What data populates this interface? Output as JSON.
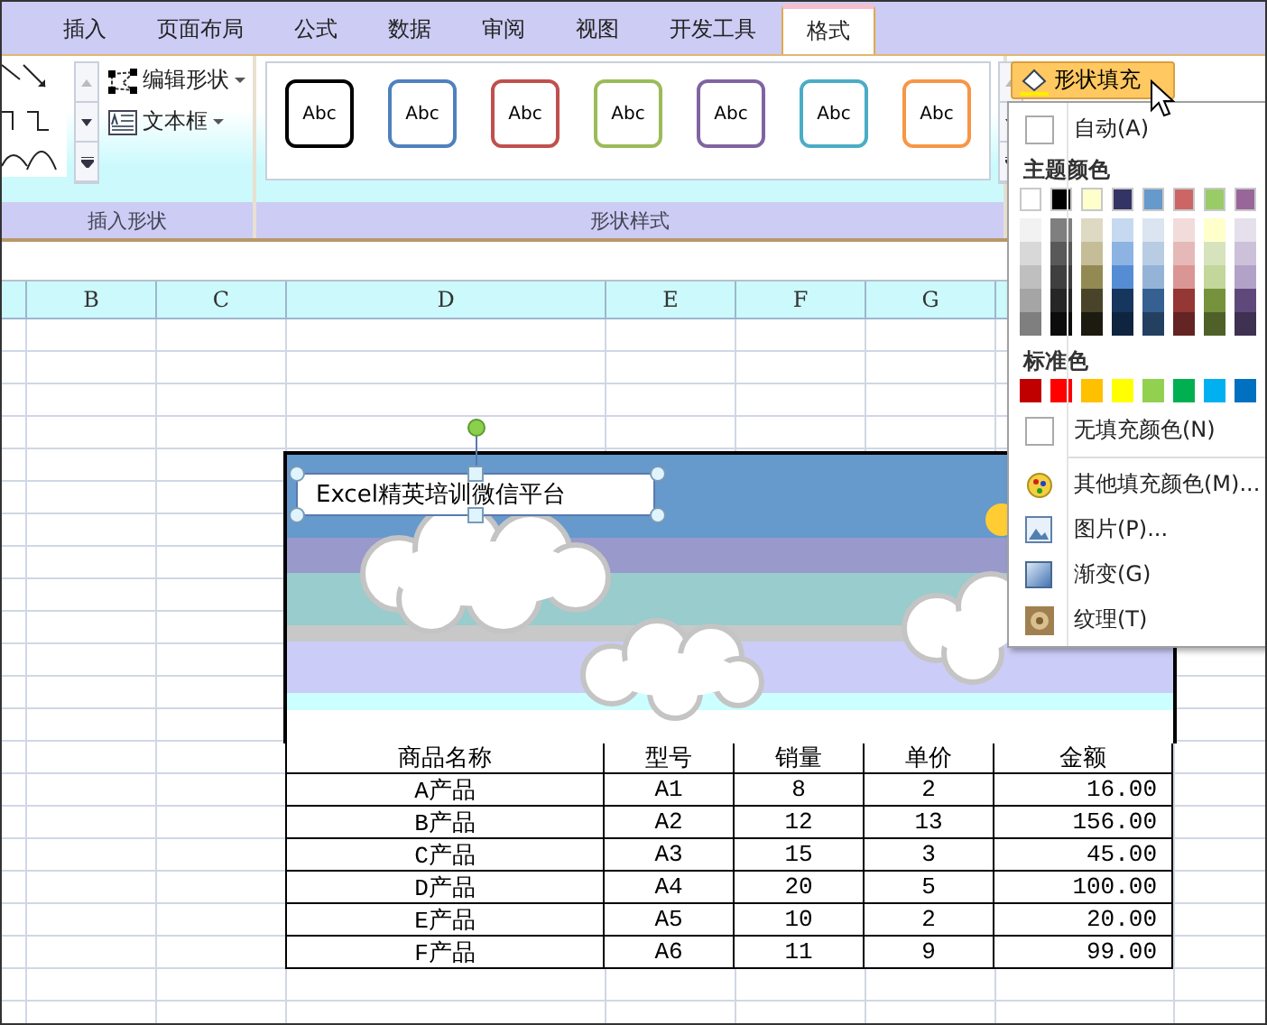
{
  "ribbon_tabs": [
    {
      "label": "插入",
      "selected": false
    },
    {
      "label": "页面布局",
      "selected": false
    },
    {
      "label": "公式",
      "selected": false
    },
    {
      "label": "数据",
      "selected": false
    },
    {
      "label": "审阅",
      "selected": false
    },
    {
      "label": "视图",
      "selected": false
    },
    {
      "label": "开发工具",
      "selected": false
    },
    {
      "label": "格式",
      "selected": true
    }
  ],
  "insert_shapes_group": {
    "label": "插入形状",
    "buttons": [
      {
        "kind": "edit-shape",
        "label": "编辑形状"
      },
      {
        "kind": "text-box",
        "label": "文本框"
      }
    ]
  },
  "shape_styles_group": {
    "label": "形状样式",
    "styles": [
      {
        "label": "Abc",
        "color": "#000000"
      },
      {
        "label": "Abc",
        "color": "#4f81bd"
      },
      {
        "label": "Abc",
        "color": "#c0504d"
      },
      {
        "label": "Abc",
        "color": "#9bbb59"
      },
      {
        "label": "Abc",
        "color": "#8064a2"
      },
      {
        "label": "Abc",
        "color": "#4bacc6"
      },
      {
        "label": "Abc",
        "color": "#f79646"
      }
    ]
  },
  "shape_fill_button": {
    "label": "形状填充"
  },
  "columns": [
    {
      "label": "B"
    },
    {
      "label": "C"
    },
    {
      "label": "D"
    },
    {
      "label": "E"
    },
    {
      "label": "F"
    },
    {
      "label": "G"
    }
  ],
  "text_box": {
    "text": "Excel精英培训微信平台"
  },
  "table": {
    "columns": [
      "商品名称",
      "型号",
      "销量",
      "单价",
      "金额"
    ],
    "rows": [
      [
        "A产品",
        "A1",
        "8",
        "2",
        "16.00"
      ],
      [
        "B产品",
        "A2",
        "12",
        "13",
        "156.00"
      ],
      [
        "C产品",
        "A3",
        "15",
        "3",
        "45.00"
      ],
      [
        "D产品",
        "A4",
        "20",
        "5",
        "100.00"
      ],
      [
        "E产品",
        "A5",
        "10",
        "2",
        "20.00"
      ],
      [
        "F产品",
        "A6",
        "11",
        "9",
        "99.00"
      ]
    ]
  },
  "fill_menu": {
    "auto": "自动(A)",
    "theme_label": "主题颜色",
    "theme_colors": [
      {
        "color": "#ffffff",
        "shades": [
          {
            "color": "#f2f2f2"
          },
          {
            "color": "#d8d8d8"
          },
          {
            "color": "#bfbfbf"
          },
          {
            "color": "#a5a5a5"
          },
          {
            "color": "#7f7f7f"
          }
        ]
      },
      {
        "color": "#000000",
        "shades": [
          {
            "color": "#7f7f7f"
          },
          {
            "color": "#595959"
          },
          {
            "color": "#3f3f3f"
          },
          {
            "color": "#262626"
          },
          {
            "color": "#0c0c0c"
          }
        ]
      },
      {
        "color": "#ffffcc",
        "shades": [
          {
            "color": "#ddd9c3"
          },
          {
            "color": "#c4bd97"
          },
          {
            "color": "#938953"
          },
          {
            "color": "#494429"
          },
          {
            "color": "#1d1b10"
          }
        ]
      },
      {
        "color": "#333366",
        "shades": [
          {
            "color": "#c6d9f0"
          },
          {
            "color": "#8db3e2"
          },
          {
            "color": "#548dd4"
          },
          {
            "color": "#17365d"
          },
          {
            "color": "#0f243e"
          }
        ]
      },
      {
        "color": "#6699cc",
        "shades": [
          {
            "color": "#dbe5f1"
          },
          {
            "color": "#b8cce4"
          },
          {
            "color": "#95b3d7"
          },
          {
            "color": "#366092"
          },
          {
            "color": "#244061"
          }
        ]
      },
      {
        "color": "#cc6666",
        "shades": [
          {
            "color": "#f2dcdb"
          },
          {
            "color": "#e5b9b7"
          },
          {
            "color": "#d99694"
          },
          {
            "color": "#953734"
          },
          {
            "color": "#632423"
          }
        ]
      },
      {
        "color": "#99cc66",
        "shades": [
          {
            "color": "#ffffcc"
          },
          {
            "color": "#d7e3bc"
          },
          {
            "color": "#c3d69b"
          },
          {
            "color": "#76923c"
          },
          {
            "color": "#4f6128"
          }
        ]
      },
      {
        "color": "#996699",
        "shades": [
          {
            "color": "#e5e0ec"
          },
          {
            "color": "#ccc1d9"
          },
          {
            "color": "#b2a2c7"
          },
          {
            "color": "#5f497a"
          },
          {
            "color": "#3f3151"
          }
        ]
      }
    ],
    "standard_label": "标准色",
    "standard_colors": [
      {
        "color": "#c00000"
      },
      {
        "color": "#ff0000"
      },
      {
        "color": "#ffc000"
      },
      {
        "color": "#ffff00"
      },
      {
        "color": "#92d050"
      },
      {
        "color": "#00b050"
      },
      {
        "color": "#00b0f0"
      },
      {
        "color": "#0070c0"
      }
    ],
    "items": [
      {
        "kind": "no-fill",
        "label": "无填充颜色(N)"
      },
      {
        "kind": "more-colors",
        "label": "其他填充颜色(M)..."
      },
      {
        "kind": "picture",
        "label": "图片(P)..."
      },
      {
        "kind": "gradient",
        "label": "渐变(G)"
      },
      {
        "kind": "texture",
        "label": "纹理(T)"
      }
    ]
  }
}
